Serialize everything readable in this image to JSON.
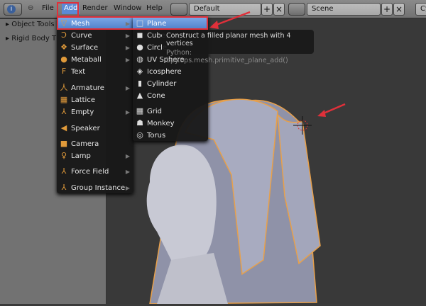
{
  "header": {
    "menus": [
      "File",
      "Add",
      "Render",
      "Window",
      "Help"
    ],
    "screen_layout": "Default",
    "scene": "Scene",
    "engine_partial": "Cy"
  },
  "tool_shelf": {
    "panels": [
      "Object Tools",
      "Rigid Body T"
    ]
  },
  "add_menu": {
    "items": [
      {
        "label": "Mesh",
        "icon": "mesh-icon",
        "submenu": true,
        "highlighted": true
      },
      {
        "label": "Curve",
        "icon": "curve-icon",
        "submenu": true
      },
      {
        "label": "Surface",
        "icon": "surface-icon",
        "submenu": true
      },
      {
        "label": "Metaball",
        "icon": "metaball-icon",
        "submenu": true
      },
      {
        "label": "Text",
        "icon": "text-icon",
        "submenu": false
      },
      {
        "label": "Armature",
        "icon": "armature-icon",
        "submenu": true
      },
      {
        "label": "Lattice",
        "icon": "lattice-icon",
        "submenu": false
      },
      {
        "label": "Empty",
        "icon": "empty-icon",
        "submenu": true
      },
      {
        "label": "Speaker",
        "icon": "speaker-icon",
        "submenu": false
      },
      {
        "label": "Camera",
        "icon": "camera-icon",
        "submenu": false
      },
      {
        "label": "Lamp",
        "icon": "lamp-icon",
        "submenu": true
      },
      {
        "label": "Force Field",
        "icon": "force-field-icon",
        "submenu": true
      },
      {
        "label": "Group Instance",
        "icon": "group-instance-icon",
        "submenu": true
      }
    ]
  },
  "mesh_menu": {
    "items": [
      "Plane",
      "Cube",
      "Circle",
      "UV Sphere",
      "Icosphere",
      "Cylinder",
      "Cone",
      "Grid",
      "Monkey",
      "Torus"
    ]
  },
  "tooltip": {
    "description": "Construct a filled planar mesh with 4 vertices",
    "python": "Python: bpy.ops.mesh.primitive_plane_add()"
  },
  "colors": {
    "highlight": "#5b8ad6",
    "annotation": "#e0303a",
    "selection_outline": "#e8a04a"
  }
}
